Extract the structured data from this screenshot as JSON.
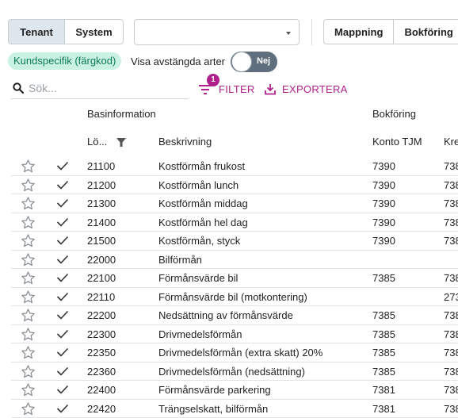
{
  "toolbar": {
    "scope_tabs": [
      {
        "label": "Tenant",
        "active": true
      },
      {
        "label": "System",
        "active": false
      }
    ],
    "dropdown_value": "",
    "view_tabs": [
      {
        "label": "Mappning"
      },
      {
        "label": "Bokföring"
      }
    ]
  },
  "filters": {
    "chip_label": "Kundspecifik (färgkod)",
    "switch_label": "Visa avstängda arter",
    "switch_value": "Nej",
    "search_placeholder": "Sök...",
    "filter_label": "FILTER",
    "filter_badge": "1",
    "export_label": "EXPORTERA"
  },
  "colors": {
    "accent": "#b0208a",
    "chip_bg": "#c9f2e2",
    "chip_text": "#0e7a5c",
    "switch_bg": "#5f6f7e",
    "active_tab_bg": "#dfe7ee"
  },
  "table": {
    "group_headers": [
      "Basinformation",
      "Bokföring"
    ],
    "columns": [
      "Lö...",
      "Beskrivning",
      "Konto TJM",
      "Kre"
    ],
    "rows": [
      {
        "code": "21100",
        "desc": "Kostförmån frukost",
        "konto": "7390",
        "kre": "738"
      },
      {
        "code": "21200",
        "desc": "Kostförmån lunch",
        "konto": "7390",
        "kre": "738"
      },
      {
        "code": "21300",
        "desc": "Kostförmån middag",
        "konto": "7390",
        "kre": "738"
      },
      {
        "code": "21400",
        "desc": "Kostförmån hel dag",
        "konto": "7390",
        "kre": "738"
      },
      {
        "code": "21500",
        "desc": "Kostförmån, styck",
        "konto": "7390",
        "kre": "738"
      },
      {
        "code": "22000",
        "desc": "Bilförmån",
        "konto": "",
        "kre": ""
      },
      {
        "code": "22100",
        "desc": "Förmånsvärde bil",
        "konto": "7385",
        "kre": "738"
      },
      {
        "code": "22110",
        "desc": "Förmånsvärde bil (motkontering)",
        "konto": "",
        "kre": "273"
      },
      {
        "code": "22200",
        "desc": "Nedsättning av förmånsvärde",
        "konto": "7385",
        "kre": "738"
      },
      {
        "code": "22300",
        "desc": "Drivmedelsförmån",
        "konto": "7385",
        "kre": "738"
      },
      {
        "code": "22350",
        "desc": "Drivmedelsförmån (extra skatt) 20%",
        "konto": "7385",
        "kre": "738"
      },
      {
        "code": "22360",
        "desc": "Drivmedelsförmån (nedsättning)",
        "konto": "7385",
        "kre": "738"
      },
      {
        "code": "22400",
        "desc": "Förmånsvärde parkering",
        "konto": "7381",
        "kre": "738"
      },
      {
        "code": "22420",
        "desc": "Trängselskatt, bilförmån",
        "konto": "7381",
        "kre": "738"
      }
    ]
  }
}
